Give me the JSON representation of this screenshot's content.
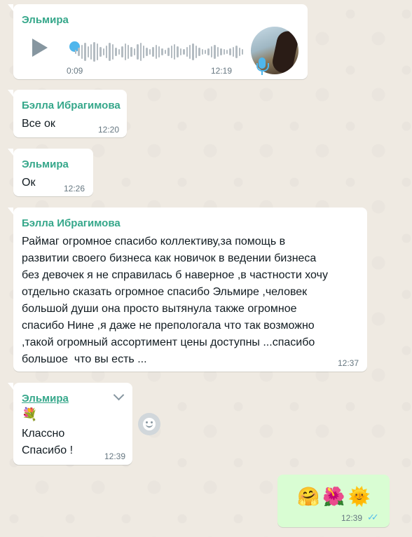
{
  "messages": [
    {
      "sender": "Эльмира",
      "type": "voice",
      "duration": "0:09",
      "time": "12:19",
      "icons": [
        "play-icon",
        "microphone-icon"
      ]
    },
    {
      "sender": "Бэлла Ибрагимова",
      "text": "Все ок",
      "time": "12:20"
    },
    {
      "sender": "Эльмира",
      "text": "Ок",
      "time": "12:26"
    },
    {
      "sender": "Бэлла Ибрагимова",
      "lines": [
        "Раймаг огромное спасибо коллективу,за помощь в",
        "развитии своего бизнеса как новичок в ведении бизнеса",
        "без девочек я не справилась б наверное ,в частности хочу",
        "отдельно сказать огромное спасибо Эльмире ,человек",
        "большой души она просто вытянула также огромное",
        "спасибо Нине ,я даже не препологала что так возможно",
        ",такой огромный ассортимент цены доступны ...спасибо",
        "большое  что вы есть ..."
      ],
      "time": "12:37"
    },
    {
      "sender": "Эльмира",
      "emoji": "💐",
      "lines": [
        "Классно",
        "Спасибо !"
      ],
      "time": "12:39"
    },
    {
      "outgoing": true,
      "emoji": "🤗🌺🌞",
      "time": "12:39",
      "status": "read"
    }
  ],
  "colors": {
    "background": "#efeae2",
    "incoming": "#ffffff",
    "outgoing": "#d9fdd3",
    "sender": "#35a78a",
    "read_ticks": "#53bdeb"
  }
}
